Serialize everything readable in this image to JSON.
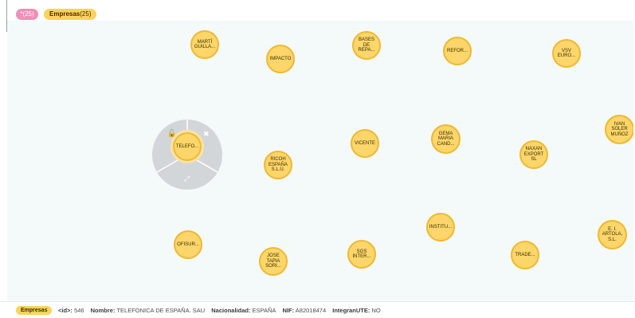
{
  "legend": {
    "all_label": "*(25)",
    "empresas_label": "Empresas",
    "empresas_count": "(25)"
  },
  "nodes": [
    {
      "id": "marti",
      "label": "MARTÍ\nGUILLA..."
    },
    {
      "id": "impacto",
      "label": "IMPACTO"
    },
    {
      "id": "bases",
      "label": "BASES\nDE\nREPA..."
    },
    {
      "id": "refor",
      "label": "REFOR..."
    },
    {
      "id": "vsv",
      "label": "VSV\nEURO..."
    },
    {
      "id": "ivan",
      "label": "IVAN\nSOLER\nMUÑOZ"
    },
    {
      "id": "telefonica",
      "label": "TELEFO..."
    },
    {
      "id": "vicente",
      "label": "VICENTE"
    },
    {
      "id": "gema",
      "label": "GEMA\nMARIA\nCAND..."
    },
    {
      "id": "naxan",
      "label": "NAXAN\nEXPORT\nSL"
    },
    {
      "id": "ricoh",
      "label": "RICOH\nESPAÑA\nS.L.U."
    },
    {
      "id": "institu",
      "label": "INSTITU..."
    },
    {
      "id": "artola",
      "label": "E. I.\nARTOLA,\nS.L."
    },
    {
      "id": "ofisur",
      "label": "OFISUR..."
    },
    {
      "id": "sgs",
      "label": "SGS\nINTER..."
    },
    {
      "id": "trade",
      "label": "TRADE..."
    },
    {
      "id": "jose",
      "label": "JOSE\nTAPIA\nSORI..."
    }
  ],
  "ring_menu": {
    "lock_icon": "🔓",
    "close_icon": "✖",
    "expand_icon": "⤢"
  },
  "footer": {
    "tag": "Empresas",
    "id_key": "<id>:",
    "id_val": "546",
    "nombre_key": "Nombre:",
    "nombre_val": "TELEFONICA DE ESPAÑA. SAU",
    "nac_key": "Nacionalidad:",
    "nac_val": "ESPAÑA",
    "nif_key": "NIF:",
    "nif_val": "A82018474",
    "ute_key": "IntegranUTE:",
    "ute_val": "NO"
  },
  "colors": {
    "node_fill": "#fcd66a",
    "node_border": "#f1b82f",
    "all_pill": "#f28fb4",
    "canvas_bg": "#f4f9f9"
  }
}
